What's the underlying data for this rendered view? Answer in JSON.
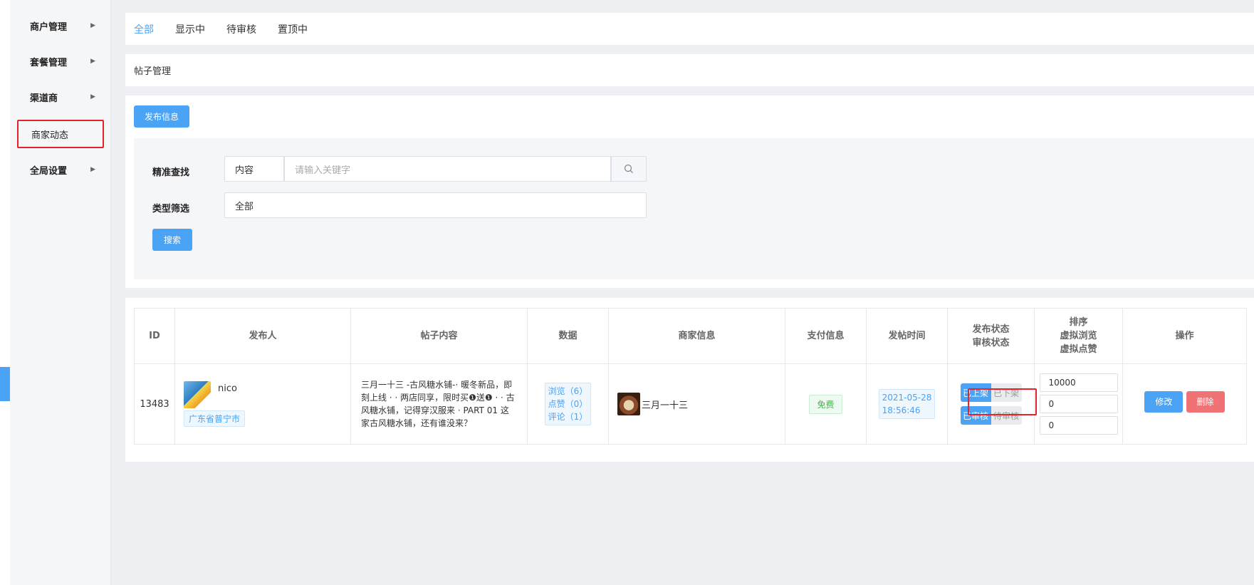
{
  "sidebar": {
    "items": [
      {
        "label": "商户管理"
      },
      {
        "label": "套餐管理"
      },
      {
        "label": "渠道商"
      },
      {
        "label": "商家动态"
      },
      {
        "label": "全局设置"
      }
    ]
  },
  "tabs": [
    "全部",
    "显示中",
    "待审核",
    "置顶中"
  ],
  "breadcrumb": "帖子管理",
  "publish_button": "发布信息",
  "filter": {
    "exact_label": "精准查找",
    "field_select": "内容",
    "keyword_placeholder": "请输入关键字",
    "type_label": "类型筛选",
    "type_value": "全部",
    "search_button": "搜索"
  },
  "table": {
    "headers": {
      "id": "ID",
      "publisher": "发布人",
      "content": "帖子内容",
      "data": "数据",
      "shop": "商家信息",
      "pay": "支付信息",
      "time": "发帖时间",
      "status_1": "发布状态",
      "status_2": "审核状态",
      "sort_1": "排序",
      "sort_2": "虚拟浏览",
      "sort_3": "虚拟点赞",
      "ops": "操作"
    },
    "row": {
      "id": "13483",
      "publisher_name": "nico",
      "publisher_location": "广东省普宁市",
      "content": "三月一十三 -古风糖水铺-· 暖冬新品，即刻上线 · · 两店同享，限时买❶送❶ · · 古风糖水铺，记得穿汉服来 · PART 01 这家古风糖水铺，还有谁没来？",
      "views": "浏览（6）",
      "likes": "点赞（0）",
      "comments": "评论（1）",
      "shop_name": "三月一十三",
      "pay": "免费",
      "date": "2021-05-28",
      "time": "18:56:46",
      "publish_on": "已上架",
      "publish_off": "已下架",
      "review_done": "已审核",
      "review_pending": "待审核",
      "sort": "10000",
      "virtual_views": "0",
      "virtual_likes": "0",
      "edit_button": "修改",
      "delete_button": "删除"
    }
  },
  "colors": {
    "accent": "#4aa3f5",
    "danger": "#f07275",
    "highlight_border": "#e8222a",
    "free_green": "#4caf50"
  }
}
